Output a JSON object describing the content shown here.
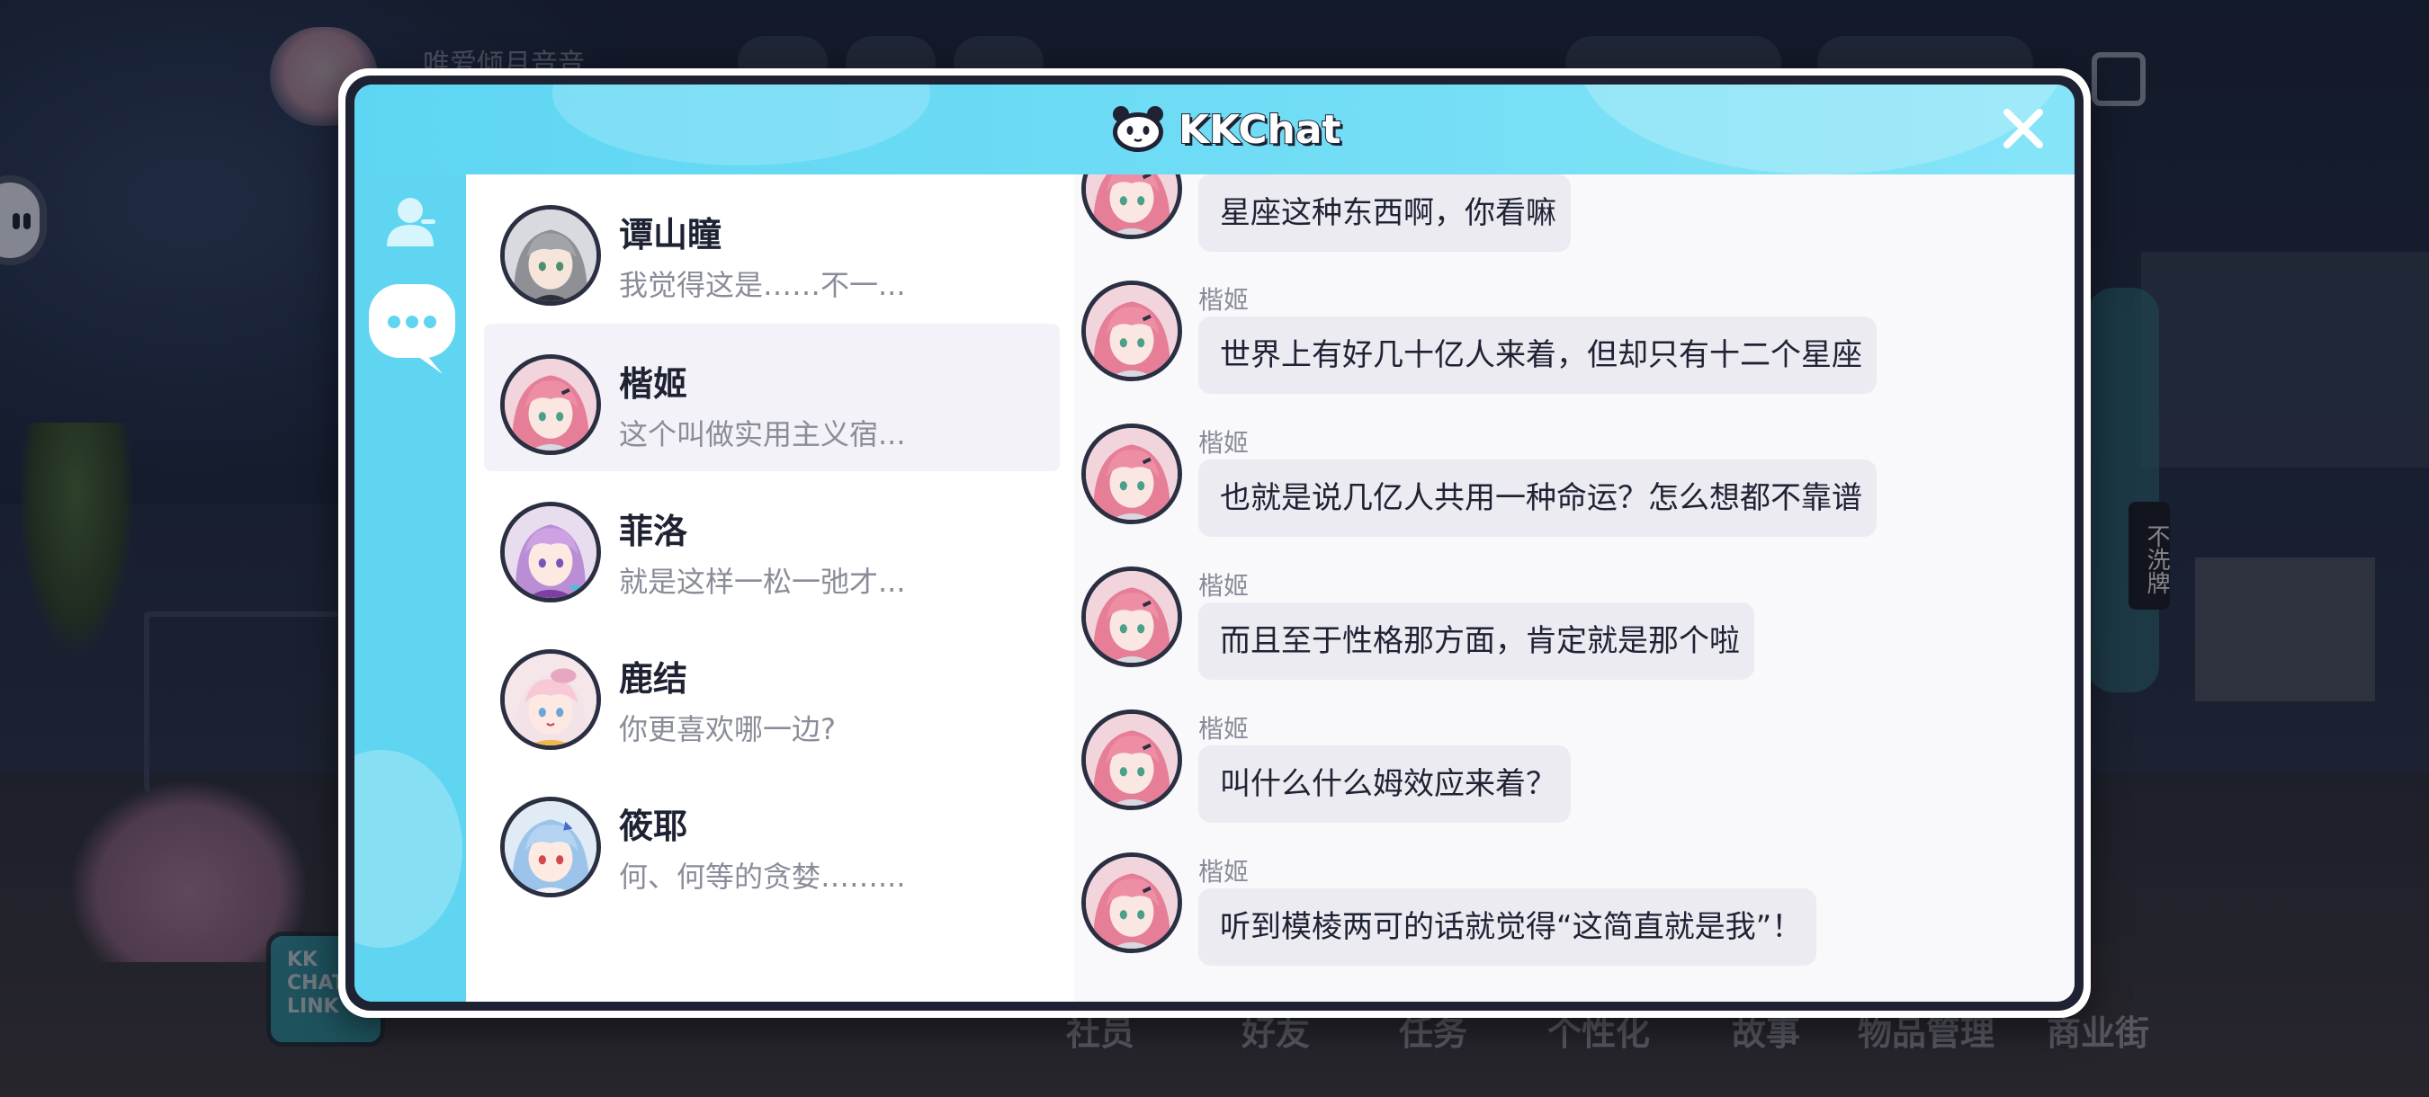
{
  "background": {
    "hud_name": "唯爱倾月音音",
    "side_tag": "不洗牌",
    "kk_badge": "KK CHAT LINK ON",
    "nav": [
      "社员",
      "好友",
      "任务",
      "个性化",
      "故事",
      "物品管理",
      "商业街"
    ]
  },
  "modal": {
    "title": "KKChat",
    "close_icon": "close-icon"
  },
  "sidebar": {
    "items": [
      {
        "icon": "contacts-icon"
      },
      {
        "icon": "chat-bubble-icon"
      }
    ]
  },
  "contacts": [
    {
      "name": "谭山瞳",
      "preview": "我觉得这是……不一...",
      "avatar": "gray-hair"
    },
    {
      "name": "楷姬",
      "preview": "这个叫做实用主义宿...",
      "avatar": "pink-hair"
    },
    {
      "name": "菲洛",
      "preview": "就是这样一松一弛才...",
      "avatar": "purple-hair"
    },
    {
      "name": "鹿结",
      "preview": "你更喜欢哪一边?",
      "avatar": "pink-white-hair"
    },
    {
      "name": "筱耶",
      "preview": "何、何等的贪婪……...",
      "avatar": "blue-hair"
    }
  ],
  "chat": {
    "messages": [
      {
        "sender": "楷姬",
        "text": "星座这种东西啊，你看嘛"
      },
      {
        "sender": "楷姬",
        "text": "世界上有好几十亿人来着，但却只有十二个星座"
      },
      {
        "sender": "楷姬",
        "text": "也就是说几亿人共用一种命运？怎么想都不靠谱"
      },
      {
        "sender": "楷姬",
        "text": "而且至于性格那方面，肯定就是那个啦"
      },
      {
        "sender": "楷姬",
        "text": "叫什么什么姆效应来着？"
      },
      {
        "sender": "楷姬",
        "text": "听到模棱两可的话就觉得“这简直就是我”！"
      }
    ]
  }
}
